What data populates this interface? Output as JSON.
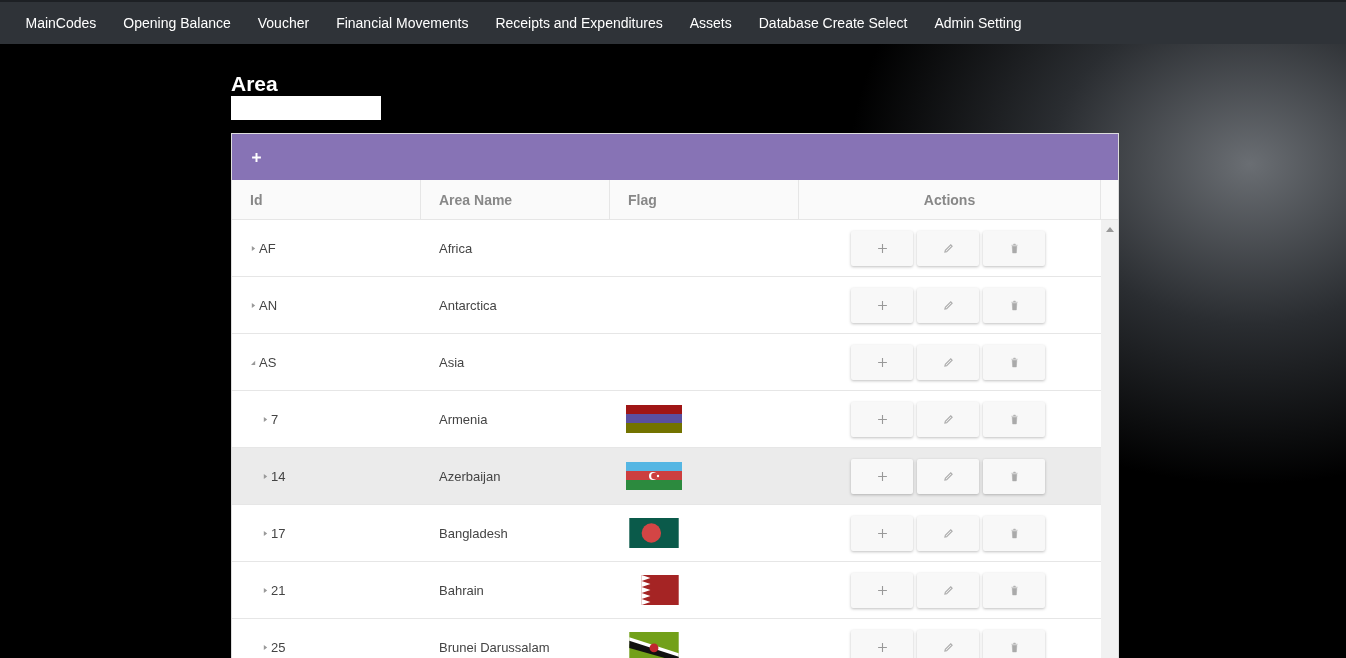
{
  "nav": {
    "items": [
      {
        "label": "MainCodes"
      },
      {
        "label": "Opening Balance"
      },
      {
        "label": "Voucher"
      },
      {
        "label": "Financial Movements"
      },
      {
        "label": "Receipts and Expenditures"
      },
      {
        "label": "Assets"
      },
      {
        "label": "Database Create Select"
      },
      {
        "label": "Admin Setting"
      }
    ]
  },
  "page": {
    "title": "Area"
  },
  "table": {
    "columns": [
      "Id",
      "Area Name",
      "Flag",
      "Actions"
    ],
    "rows": [
      {
        "id": "AF",
        "name": "Africa",
        "expanded": false,
        "selected": false
      },
      {
        "id": "AN",
        "name": "Antarctica",
        "expanded": false,
        "selected": false
      },
      {
        "id": "AS",
        "name": "Asia",
        "expanded": true,
        "selected": false,
        "children": [
          {
            "id": "7",
            "name": "Armenia",
            "kind": "armenia",
            "expanded": false,
            "selected": false
          },
          {
            "id": "14",
            "name": "Azerbaijan",
            "kind": "azerbaijan",
            "expanded": false,
            "selected": true
          },
          {
            "id": "17",
            "name": "Bangladesh",
            "kind": "bangladesh",
            "expanded": false,
            "selected": false
          },
          {
            "id": "21",
            "name": "Bahrain",
            "kind": "bahrain",
            "expanded": false,
            "selected": false
          },
          {
            "id": "25",
            "name": "Brunei Darussalam",
            "kind": "brunei",
            "expanded": false,
            "selected": false
          }
        ]
      }
    ]
  }
}
